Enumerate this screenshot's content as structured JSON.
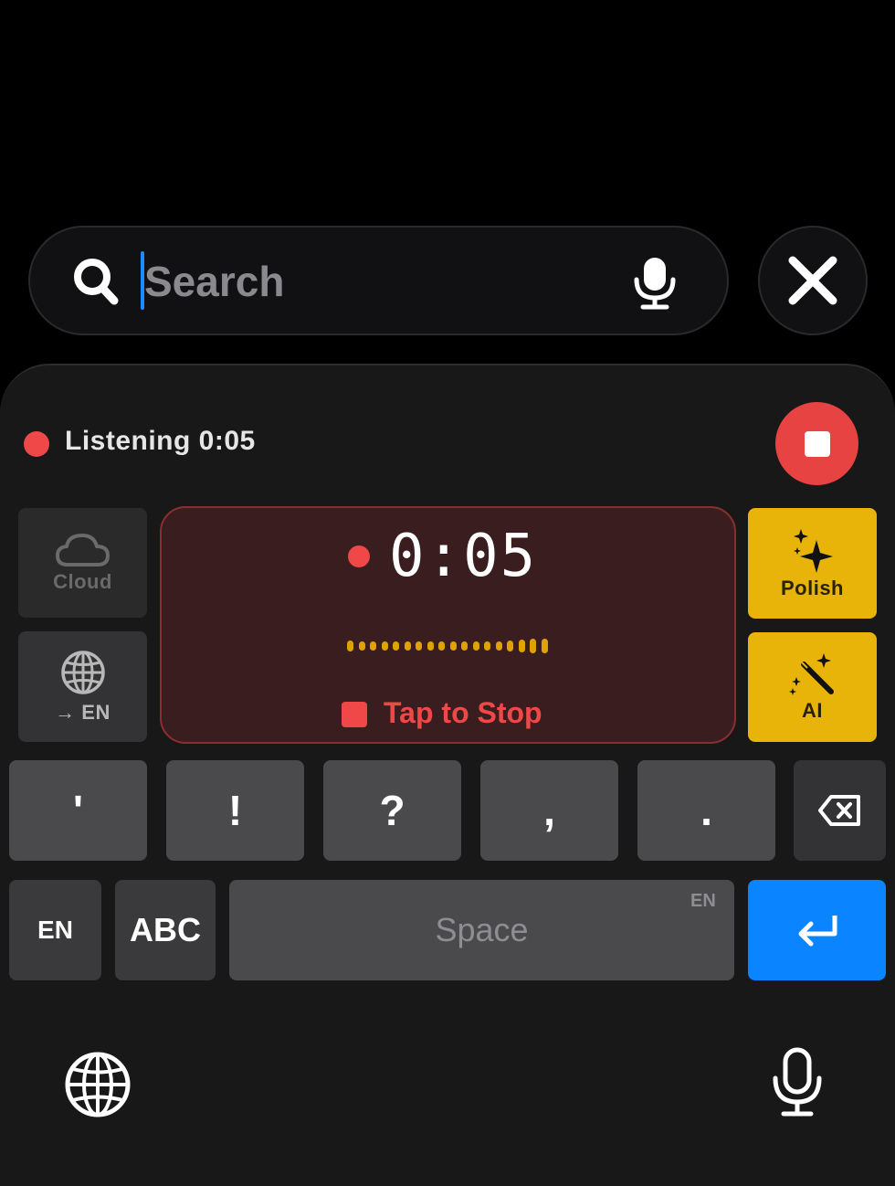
{
  "search": {
    "placeholder": "Search",
    "value": ""
  },
  "recording": {
    "status_label": "Listening 0:05",
    "timer": "0:05",
    "tap_to_stop": "Tap to Stop"
  },
  "side_tiles": {
    "cloud_label": "Cloud",
    "translate_label": "→ EN",
    "polish_label": "Polish",
    "ai_label": "AI"
  },
  "keys": {
    "punctuation": [
      "'",
      "!",
      "?",
      ",",
      "."
    ],
    "lang": "EN",
    "abc": "ABC",
    "space": "Space",
    "space_lang_hint": "EN"
  },
  "colors": {
    "record_red": "#f04848",
    "accent_yellow": "#e8b40a",
    "return_blue": "#0a84ff",
    "wave_amber": "#e0a200"
  }
}
